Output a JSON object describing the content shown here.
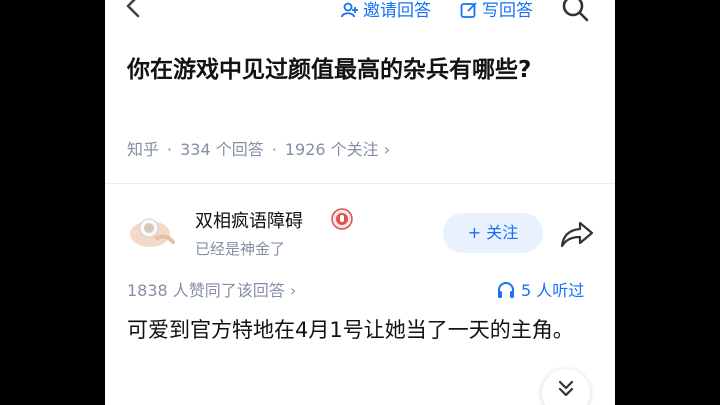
{
  "toolbar": {
    "invite_label": "邀请回答",
    "write_label": "写回答"
  },
  "question": {
    "title": "你在游戏中见过颜值最高的杂兵有哪些?",
    "source": "知乎",
    "answers": "334 个回答",
    "followers": "1926 个关注",
    "meta_arrow": "›"
  },
  "answer": {
    "author_name": "双相疯语障碍",
    "author_bio": "已经是神金了",
    "follow_label": "+ 关注",
    "likes": "1838 人赞同了该回答 ›",
    "listen": "5 人听过",
    "text": "可爱到官方特地在4月1号让她当了一天的主角。"
  },
  "colors": {
    "accent": "#1772f6",
    "follow_bg": "#e8f1fd",
    "muted": "#8590a6",
    "badge": "#d9534f"
  },
  "icons": [
    "back-icon",
    "invite-icon",
    "write-icon",
    "search-icon",
    "badge-icon",
    "share-icon",
    "headphones-icon",
    "chevron-double-down-icon"
  ]
}
